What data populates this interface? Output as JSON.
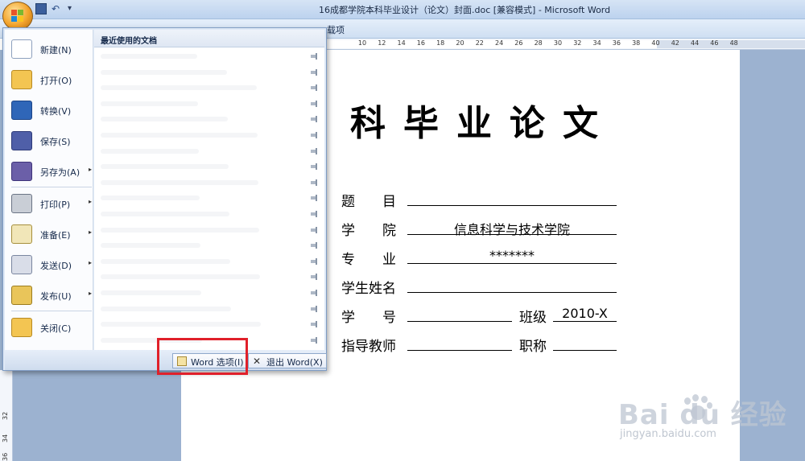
{
  "window": {
    "title": "16成都学院本科毕业设计（论文）封面.doc [兼容模式] - Microsoft Word",
    "ribbon_label": "载项"
  },
  "colors": {
    "highlight": "#e0202a",
    "office_button": "#f2a22a",
    "menu_bg": "#dfe9f6"
  },
  "ruler": {
    "ticks": [
      "10",
      "12",
      "14",
      "16",
      "18",
      "20",
      "22",
      "24",
      "26",
      "28",
      "30",
      "32",
      "34",
      "36",
      "38",
      "40",
      "42",
      "44",
      "46",
      "48"
    ],
    "vertical_ticks": [
      "32",
      "34",
      "36"
    ]
  },
  "office_menu": {
    "recent_header": "最近使用的文档",
    "items": [
      {
        "label": "新建(N)",
        "icon": "new-document-icon",
        "arrow": ""
      },
      {
        "label": "打开(O)",
        "icon": "open-folder-icon",
        "arrow": ""
      },
      {
        "label": "转换(V)",
        "icon": "convert-icon",
        "arrow": ""
      },
      {
        "label": "保存(S)",
        "icon": "save-icon",
        "arrow": ""
      },
      {
        "label": "另存为(A)",
        "icon": "save-as-icon",
        "arrow": "▸"
      },
      {
        "label": "打印(P)",
        "icon": "print-icon",
        "arrow": "▸"
      },
      {
        "label": "准备(E)",
        "icon": "prepare-icon",
        "arrow": "▸"
      },
      {
        "label": "发送(D)",
        "icon": "send-icon",
        "arrow": "▸"
      },
      {
        "label": "发布(U)",
        "icon": "publish-icon",
        "arrow": "▸"
      },
      {
        "label": "关闭(C)",
        "icon": "close-folder-icon",
        "arrow": ""
      }
    ],
    "word_options": "Word 选项(I)",
    "exit_word": "退出 Word(X)"
  },
  "document": {
    "title": "科毕业论文",
    "fields": [
      {
        "label": "题　　目",
        "value": ""
      },
      {
        "label": "学　　院",
        "value": "信息科学与技术学院"
      },
      {
        "label": "专　　业",
        "value": "*******"
      },
      {
        "label": "学生姓名",
        "value": ""
      },
      {
        "label": "学　　号",
        "value": ""
      },
      {
        "label": "指导教师",
        "value": ""
      }
    ],
    "extra_fields": [
      {
        "label": "班级",
        "value": "2010-X"
      },
      {
        "label": "职称",
        "value": ""
      }
    ]
  },
  "watermark": {
    "logo": "Bai  du 经验",
    "url": "jingyan.baidu.com"
  }
}
